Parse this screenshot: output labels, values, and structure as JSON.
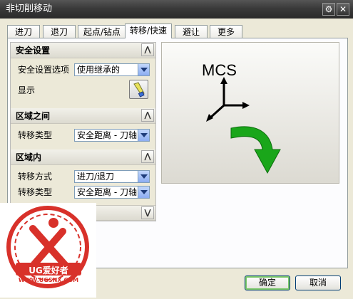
{
  "window": {
    "title": "非切削移动",
    "settings_icon": "gear-icon",
    "close_icon": "close-icon"
  },
  "tabs": [
    {
      "label": "进刀"
    },
    {
      "label": "退刀"
    },
    {
      "label": "起点/钻点"
    },
    {
      "label": "转移/快速",
      "active": true
    },
    {
      "label": "避让"
    },
    {
      "label": "更多"
    }
  ],
  "groups": {
    "safety": {
      "title": "安全设置",
      "option_label": "安全设置选项",
      "option_value": "使用继承的",
      "display_label": "显示"
    },
    "between_regions": {
      "title": "区域之间",
      "transfer_type_label": "转移类型",
      "transfer_type_value": "安全距离 - 刀轴"
    },
    "within_region": {
      "title": "区域内",
      "transfer_method_label": "转移方式",
      "transfer_method_value": "进刀/退刀",
      "transfer_type_label": "转移类型",
      "transfer_type_value": "安全距离 - 刀轴"
    }
  },
  "preview": {
    "label": "MCS",
    "arrow_color": "#1aa61a"
  },
  "watermark": {
    "brand": "UG爱好者",
    "url": "WWW.UGSNX.COM",
    "color": "#d8312a"
  },
  "buttons": {
    "ok": "确定",
    "cancel": "取消"
  }
}
